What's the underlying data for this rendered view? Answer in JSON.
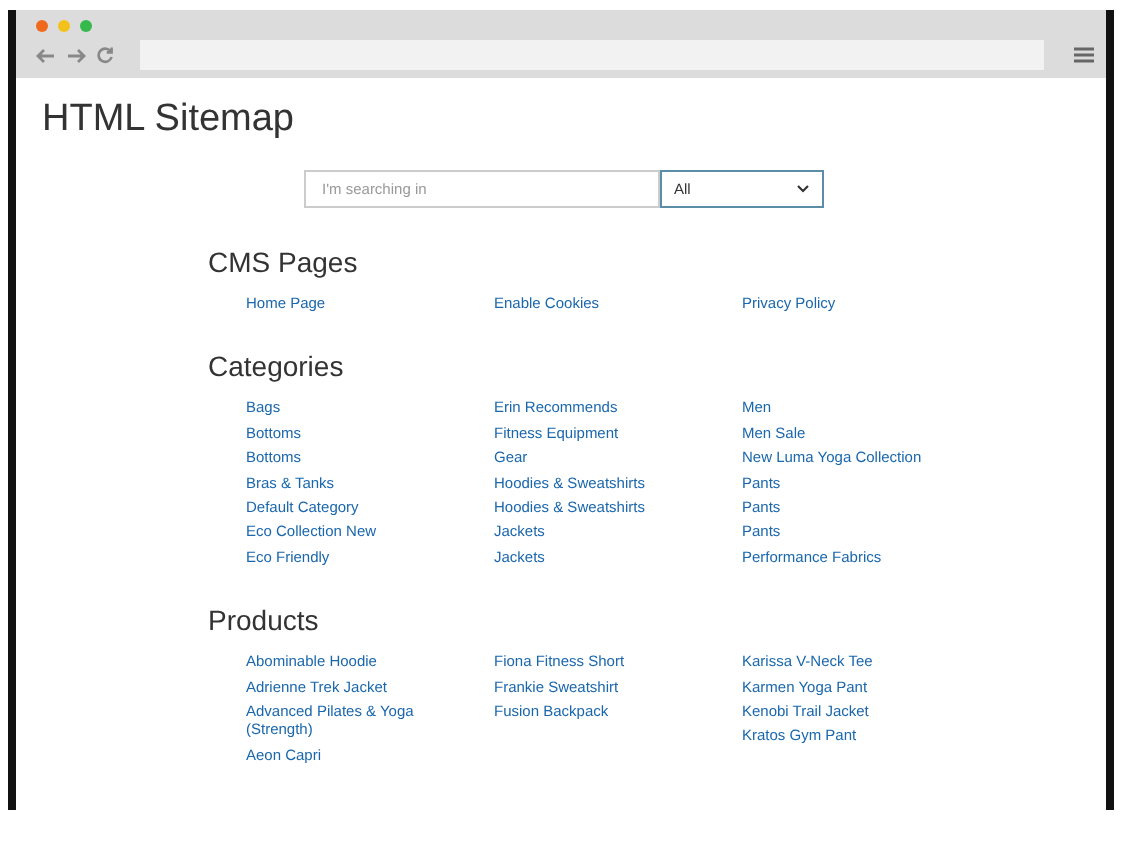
{
  "page": {
    "title": "HTML Sitemap",
    "search": {
      "placeholder": "I'm searching in",
      "scope": "All"
    },
    "sections": [
      {
        "heading": "CMS Pages",
        "columns": [
          [
            "Home Page"
          ],
          [
            "Enable Cookies"
          ],
          [
            "Privacy Policy"
          ]
        ]
      },
      {
        "heading": "Categories",
        "columns": [
          [
            "Bags",
            "Bottoms",
            "Bottoms",
            "Bras & Tanks",
            "Default Category",
            "Eco Collection New",
            "Eco Friendly"
          ],
          [
            "Erin Recommends",
            "Fitness Equipment",
            "Gear",
            "Hoodies & Sweatshirts",
            "Hoodies & Sweatshirts",
            "Jackets",
            "Jackets"
          ],
          [
            "Men",
            "Men Sale",
            "New Luma Yoga Collection",
            "Pants",
            "Pants",
            "Pants",
            "Performance Fabrics"
          ]
        ]
      },
      {
        "heading": "Products",
        "columns": [
          [
            "Abominable Hoodie",
            "Adrienne Trek Jacket",
            "Advanced Pilates & Yoga (Strength)",
            "Aeon Capri"
          ],
          [
            "Fiona Fitness Short",
            "Frankie Sweatshirt",
            "Fusion Backpack"
          ],
          [
            "Karissa V-Neck Tee",
            "Karmen Yoga Pant",
            "Kenobi Trail Jacket",
            "Kratos Gym Pant"
          ]
        ]
      }
    ]
  }
}
